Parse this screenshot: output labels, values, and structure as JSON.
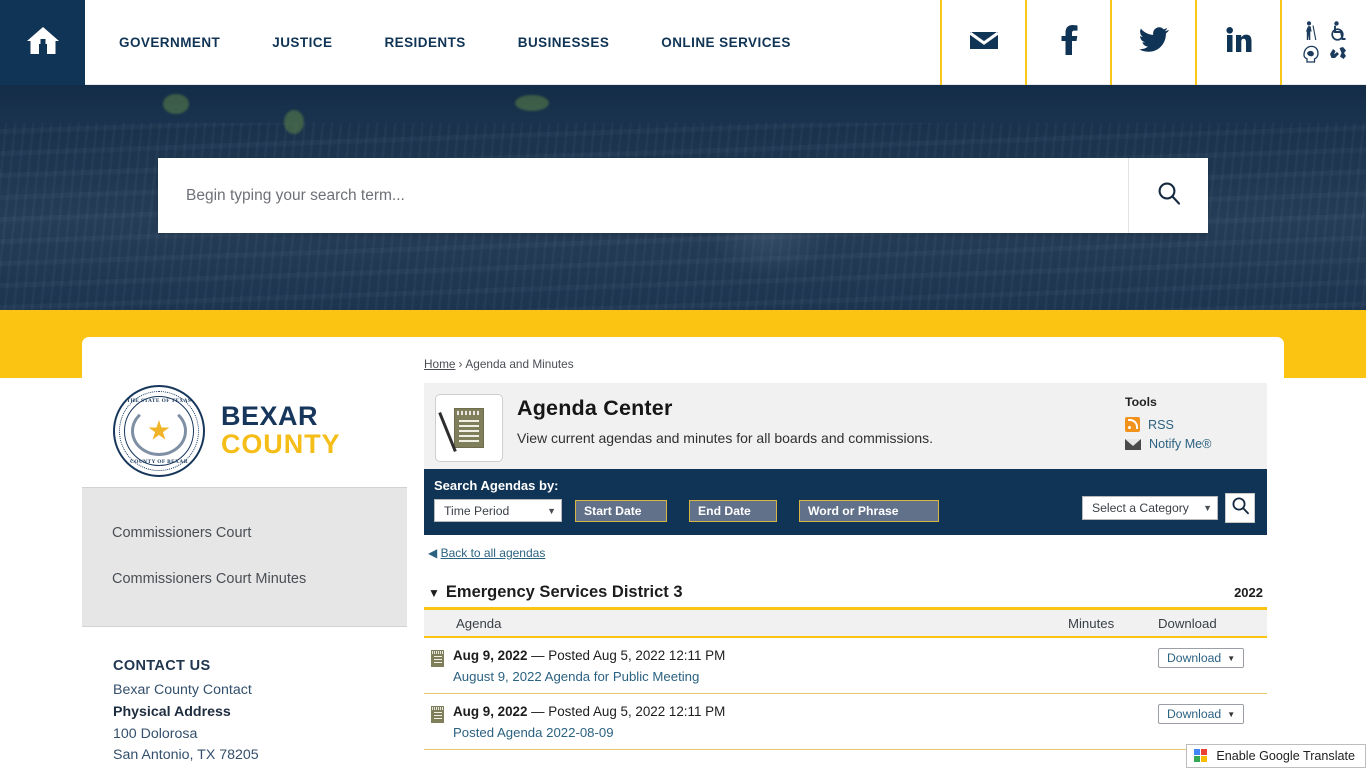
{
  "colors": {
    "navy": "#103455",
    "gold": "#fbc412",
    "link_blue": "#2c6281",
    "sidebar_gray": "#e6e6e6"
  },
  "topnav": {
    "home_icon": "home-icon",
    "links": [
      {
        "label": "GOVERNMENT"
      },
      {
        "label": "JUSTICE"
      },
      {
        "label": "RESIDENTS"
      },
      {
        "label": "BUSINESSES"
      },
      {
        "label": "ONLINE SERVICES"
      }
    ],
    "social": [
      {
        "name": "email-icon"
      },
      {
        "name": "facebook-icon"
      },
      {
        "name": "twitter-icon"
      },
      {
        "name": "linkedin-icon"
      }
    ],
    "accessibility": [
      {
        "name": "blind-person-icon"
      },
      {
        "name": "wheelchair-icon"
      },
      {
        "name": "cognitive-head-icon"
      },
      {
        "name": "sign-language-icon"
      }
    ]
  },
  "hero": {
    "search_placeholder": "Begin typing your search term...",
    "search_value": "",
    "search_button_icon": "search-icon"
  },
  "logo": {
    "seal_text_top": "THE STATE OF TEXAS",
    "seal_text_bottom": "COUNTY OF BEXAR",
    "seal_star": "★",
    "line1": "BEXAR",
    "line2": "COUNTY"
  },
  "sidebar": {
    "items": [
      {
        "label": "Commissioners Court"
      },
      {
        "label": "Commissioners Court Minutes"
      }
    ],
    "contact": {
      "heading": "CONTACT US",
      "name": "Bexar County Contact",
      "address_label": "Physical Address",
      "address_line1": "100 Dolorosa",
      "address_line2": "San Antonio, TX 78205"
    }
  },
  "breadcrumb": {
    "home": "Home",
    "separator": "›",
    "current": "Agenda and Minutes"
  },
  "page": {
    "icon": "notepad-icon",
    "title": "Agenda Center",
    "subtitle": "View current agendas and minutes for all boards and commissions."
  },
  "tools": {
    "heading": "Tools",
    "items": [
      {
        "label": "RSS",
        "icon": "rss-icon"
      },
      {
        "label": "Notify Me®",
        "icon": "envelope-icon"
      }
    ]
  },
  "search_agendas": {
    "label": "Search Agendas by:",
    "time_period": "Time Period",
    "start_date": "Start Date",
    "end_date": "End Date",
    "word_or_phrase": "Word or Phrase",
    "category": "Select a Category",
    "go_icon": "search-icon",
    "caret": "▼"
  },
  "back_link": {
    "arrow": "◀",
    "label": "Back to all agendas"
  },
  "group": {
    "triangle": "▼",
    "name": "Emergency Services District 3",
    "year": "2022"
  },
  "table": {
    "headers": {
      "agenda": "Agenda",
      "minutes": "Minutes",
      "download": "Download"
    },
    "rows": [
      {
        "date": "Aug 9, 2022",
        "posted": "— Posted Aug 5, 2022 12:11 PM",
        "link": "August 9, 2022 Agenda for Public Meeting",
        "minutes": "",
        "download_label": "Download",
        "download_caret": "▼"
      },
      {
        "date": "Aug 9, 2022",
        "posted": "— Posted Aug 5, 2022 12:11 PM",
        "link": "Posted Agenda 2022-08-09",
        "minutes": "",
        "download_label": "Download",
        "download_caret": "▼"
      }
    ]
  },
  "google_translate": {
    "label": "Enable Google Translate",
    "icon": "google-translate-icon"
  }
}
